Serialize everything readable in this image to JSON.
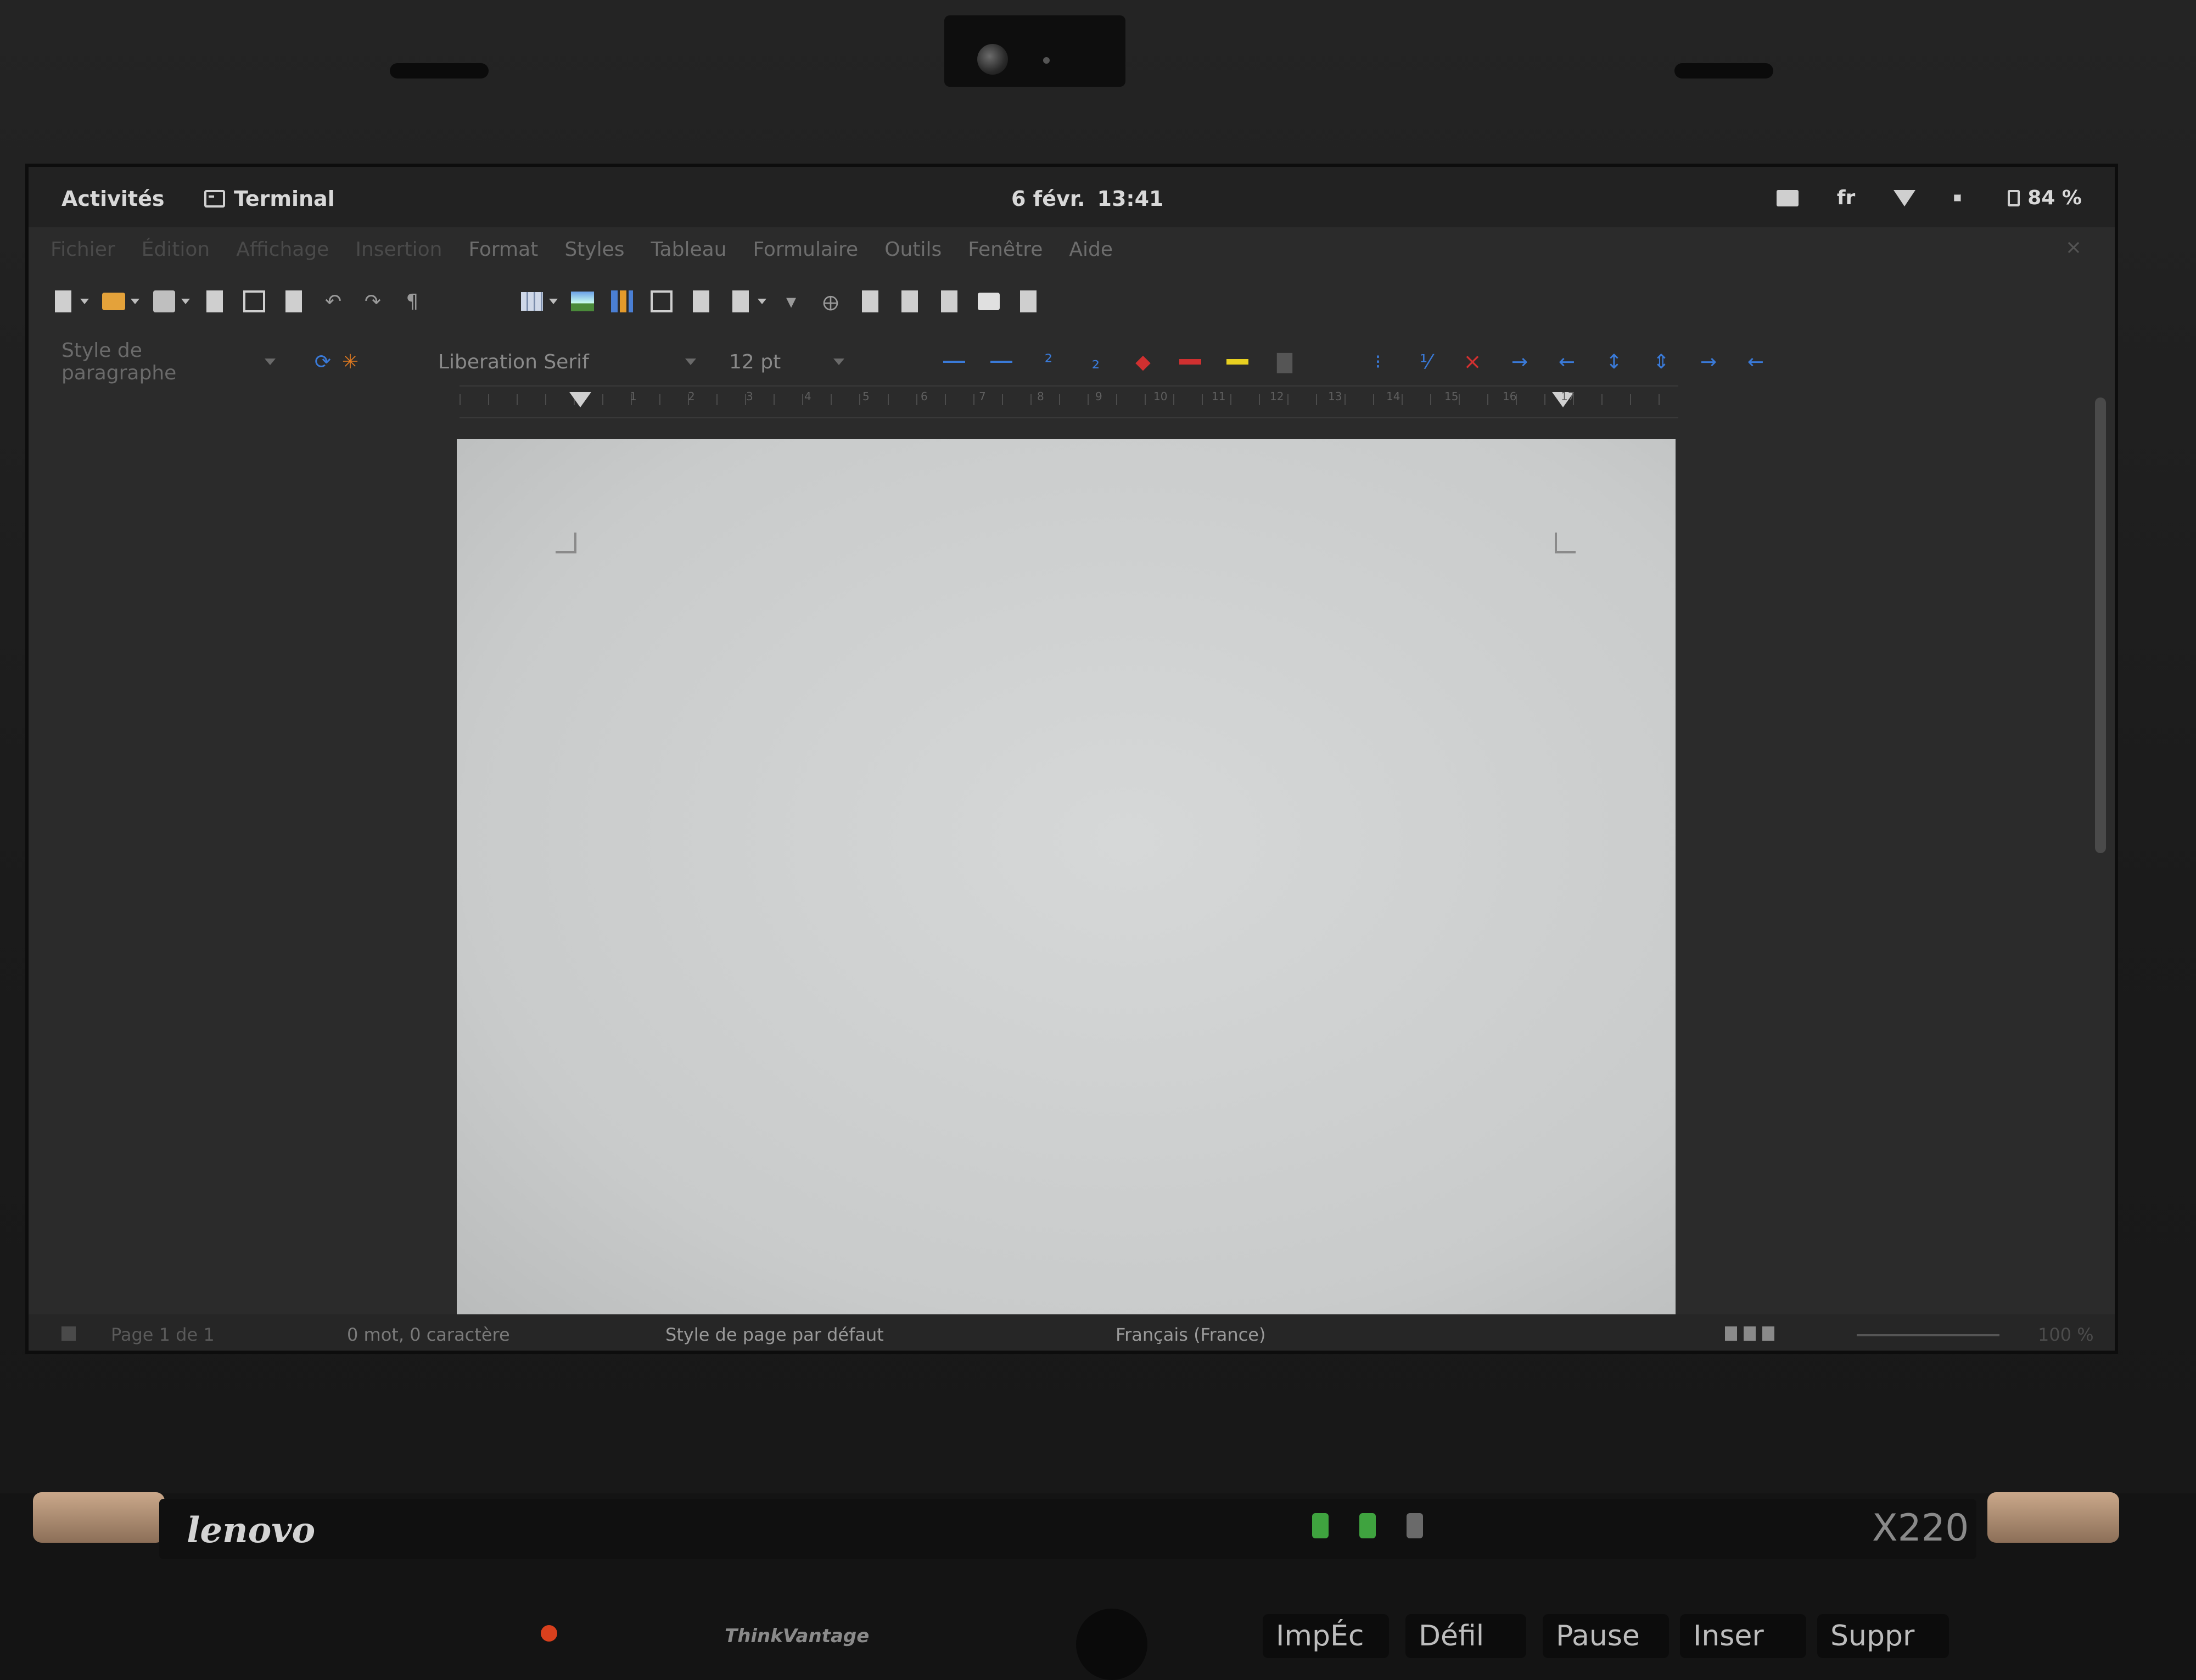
{
  "topbar": {
    "activities": "Activités",
    "app_name": "Terminal",
    "date": "6 févr.",
    "time": "13:41",
    "keyboard_layout": "fr",
    "battery": "84 %"
  },
  "menubar": {
    "items": [
      "Fichier",
      "Édition",
      "Affichage",
      "Insertion",
      "Format",
      "Styles",
      "Tableau",
      "Formulaire",
      "Outils",
      "Fenêtre",
      "Aide"
    ]
  },
  "format": {
    "paragraph_style": "Style de paragraphe",
    "font_name": "Liberation Serif",
    "font_size": "12 pt"
  },
  "ruler": {
    "numbers": [
      "1",
      "2",
      "3",
      "4",
      "5",
      "6",
      "7",
      "8",
      "9",
      "10",
      "11",
      "12",
      "13",
      "14",
      "15",
      "16",
      "17"
    ]
  },
  "statusbar": {
    "page": "Page 1 de 1",
    "words": "0 mot, 0 caractère",
    "page_style": "Style de page par défaut",
    "language": "Français (France)",
    "zoom": "100 %"
  },
  "laptop": {
    "brand": "lenovo",
    "model": "X220",
    "keyboard_label": "ThinkVantage",
    "keys": [
      "ImpÉc",
      "Défil",
      "Pause",
      "Inser",
      "Suppr"
    ]
  },
  "colors": {
    "accent_blue": "#3a7ad8",
    "font_color": "#d03030",
    "highlight": "#e8d020",
    "led_green": "#3fa33f"
  }
}
